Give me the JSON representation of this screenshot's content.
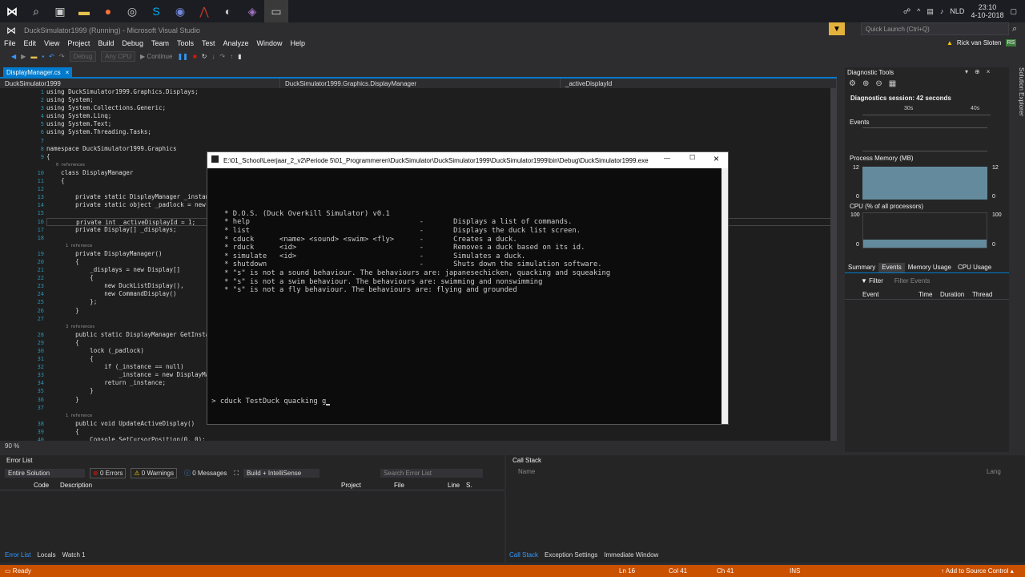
{
  "taskbar": {
    "time": "23:10",
    "date": "4-10-2018",
    "lang": "NLD"
  },
  "window": {
    "title": "DuckSimulator1999 (Running) - Microsoft Visual Studio",
    "quick_launch": "Quick Launch (Ctrl+Q)",
    "user": "Rick van Sloten",
    "user_initials": "RS"
  },
  "menu": [
    "File",
    "Edit",
    "View",
    "Project",
    "Build",
    "Debug",
    "Team",
    "Tools",
    "Test",
    "Analyze",
    "Window",
    "Help"
  ],
  "toolbar": {
    "config": "Debug",
    "platform": "Any CPU",
    "continue": "Continue"
  },
  "editor": {
    "tab": "DisplayManager.cs",
    "nav": [
      "DuckSimulator1999",
      "DuckSimulator1999.Graphics.DisplayManager",
      "_activeDisplayId"
    ],
    "zoom": "90 %",
    "lines": [
      {
        "n": "1",
        "t": "using DuckSimulator1999.Graphics.Displays;"
      },
      {
        "n": "2",
        "t": "using System;"
      },
      {
        "n": "3",
        "t": "using System.Collections.Generic;"
      },
      {
        "n": "4",
        "t": "using System.Linq;"
      },
      {
        "n": "5",
        "t": "using System.Text;"
      },
      {
        "n": "6",
        "t": "using System.Threading.Tasks;"
      },
      {
        "n": "7",
        "t": ""
      },
      {
        "n": "8",
        "t": "namespace DuckSimulator1999.Graphics"
      },
      {
        "n": "9",
        "t": "{"
      },
      {
        "n": "",
        "t": "    0 references"
      },
      {
        "n": "10",
        "t": "    class DisplayManager"
      },
      {
        "n": "11",
        "t": "    {"
      },
      {
        "n": "12",
        "t": ""
      },
      {
        "n": "13",
        "t": "        private static DisplayManager _instance"
      },
      {
        "n": "14",
        "t": "        private static object _padlock = new ob"
      },
      {
        "n": "15",
        "t": ""
      },
      {
        "n": "16",
        "t": "        private int _activeDisplayId = 1;"
      },
      {
        "n": "17",
        "t": "        private Display[] _displays;"
      },
      {
        "n": "18",
        "t": ""
      },
      {
        "n": "",
        "t": "        1 reference"
      },
      {
        "n": "19",
        "t": "        private DisplayManager()"
      },
      {
        "n": "20",
        "t": "        {"
      },
      {
        "n": "21",
        "t": "            _displays = new Display[]"
      },
      {
        "n": "22",
        "t": "            {"
      },
      {
        "n": "23",
        "t": "                new DuckListDisplay(),"
      },
      {
        "n": "24",
        "t": "                new CommandDisplay()"
      },
      {
        "n": "25",
        "t": "            };"
      },
      {
        "n": "26",
        "t": "        }"
      },
      {
        "n": "27",
        "t": ""
      },
      {
        "n": "",
        "t": "        3 references"
      },
      {
        "n": "28",
        "t": "        public static DisplayManager GetInstance"
      },
      {
        "n": "29",
        "t": "        {"
      },
      {
        "n": "30",
        "t": "            lock (_padlock)"
      },
      {
        "n": "31",
        "t": "            {"
      },
      {
        "n": "32",
        "t": "                if (_instance == null)"
      },
      {
        "n": "33",
        "t": "                    _instance = new DisplayManag"
      },
      {
        "n": "34",
        "t": "                return _instance;"
      },
      {
        "n": "35",
        "t": "            }"
      },
      {
        "n": "36",
        "t": "        }"
      },
      {
        "n": "37",
        "t": ""
      },
      {
        "n": "",
        "t": "        1 reference"
      },
      {
        "n": "38",
        "t": "        public void UpdateActiveDisplay()"
      },
      {
        "n": "39",
        "t": "        {"
      },
      {
        "n": "40",
        "t": "            Console.SetCursorPosition(0, 0);"
      }
    ]
  },
  "console": {
    "title": "E:\\01_School\\Leerjaar_2_v2\\Periode 5\\01_Programmeren\\DuckSimulator\\DuckSimulator1999\\DuckSimulator1999\\bin\\Debug\\DuckSimulator1999.exe",
    "lines": [
      "",
      "",
      "",
      "    * D.O.S. (Duck Overkill Simulator) v0.1",
      "    * help                                        -       Displays a list of commands.",
      "    * list                                        -       Displays the duck list screen.",
      "    * cduck      <name> <sound> <swim> <fly>      -       Creates a duck.",
      "    * rduck      <id>                             -       Removes a duck based on its id.",
      "    * simulate   <id>                             -       Simulates a duck.",
      "    * shutdown                                    -       Shuts down the simulation software.",
      "    * \"s\" is not a sound behaviour. The behaviours are: japanesechicken, quacking and squeaking",
      "    * \"s\" is not a swim behaviour. The behaviours are: swimming and nonswimming",
      "    * \"s\" is not a fly behaviour. The behaviours are: flying and grounded"
    ],
    "prompt": " > cduck TestDuck quacking g"
  },
  "diagnostics": {
    "title": "Diagnostic Tools",
    "session": "Diagnostics session: 42 seconds",
    "t1": "30s",
    "t2": "40s",
    "events": "Events",
    "memory": "Process Memory (MB)",
    "mem_max": "12",
    "mem_min": "0",
    "cpu": "CPU (% of all processors)",
    "cpu_max": "100",
    "cpu_min": "0",
    "tabs": [
      "Summary",
      "Events",
      "Memory Usage",
      "CPU Usage"
    ],
    "filter": "Filter",
    "filter_placeholder": "Filter Events",
    "cols": [
      "Event",
      "Time",
      "Duration",
      "Thread"
    ],
    "side": "Solution Explorer"
  },
  "errors": {
    "title": "Error List",
    "scope": "Entire Solution",
    "errors": "0 Errors",
    "warnings": "0 Warnings",
    "messages": "0 Messages",
    "build": "Build + IntelliSense",
    "search": "Search Error List",
    "cols": [
      "Code",
      "Description",
      "Project",
      "File",
      "Line",
      "S."
    ],
    "tabs": [
      "Error List",
      "Locals",
      "Watch 1"
    ]
  },
  "callstack": {
    "title": "Call Stack",
    "col_name": "Name",
    "col_lang": "Lang",
    "tabs": [
      "Call Stack",
      "Exception Settings",
      "Immediate Window"
    ]
  },
  "status": {
    "ready": "Ready",
    "ln": "Ln 16",
    "col": "Col 41",
    "ch": "Ch 41",
    "ins": "INS",
    "add": "Add to Source Control"
  }
}
